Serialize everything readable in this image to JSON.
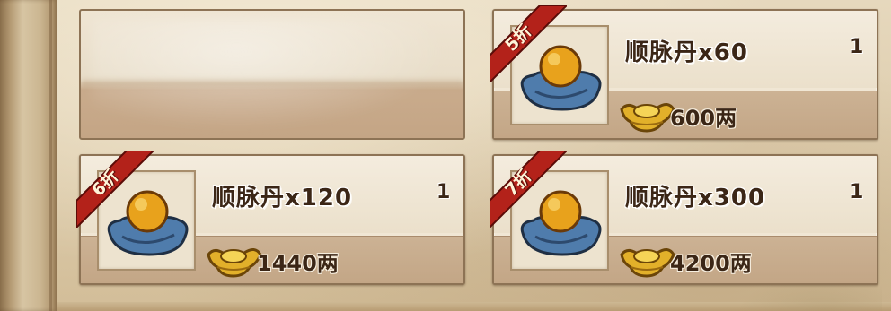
{
  "shop": {
    "items": [
      {
        "discount": "5折",
        "name": "顺脉丹x60",
        "quantity": "1",
        "price": "600两",
        "item_icon": "pill-on-cushion-icon",
        "currency_icon": "gold-ingot-icon"
      },
      {
        "discount": "6折",
        "name": "顺脉丹x120",
        "quantity": "1",
        "price": "1440两",
        "item_icon": "pill-on-cushion-icon",
        "currency_icon": "gold-ingot-icon"
      },
      {
        "discount": "7折",
        "name": "顺脉丹x300",
        "quantity": "1",
        "price": "4200两",
        "item_icon": "pill-on-cushion-icon",
        "currency_icon": "gold-ingot-icon"
      }
    ]
  },
  "colors": {
    "badge_red": "#b3221a",
    "pill_gold": "#e8a21c",
    "cushion_blue": "#4f7cac",
    "ingot_gold": "#e2b02a",
    "text_dark": "#3b2616"
  }
}
